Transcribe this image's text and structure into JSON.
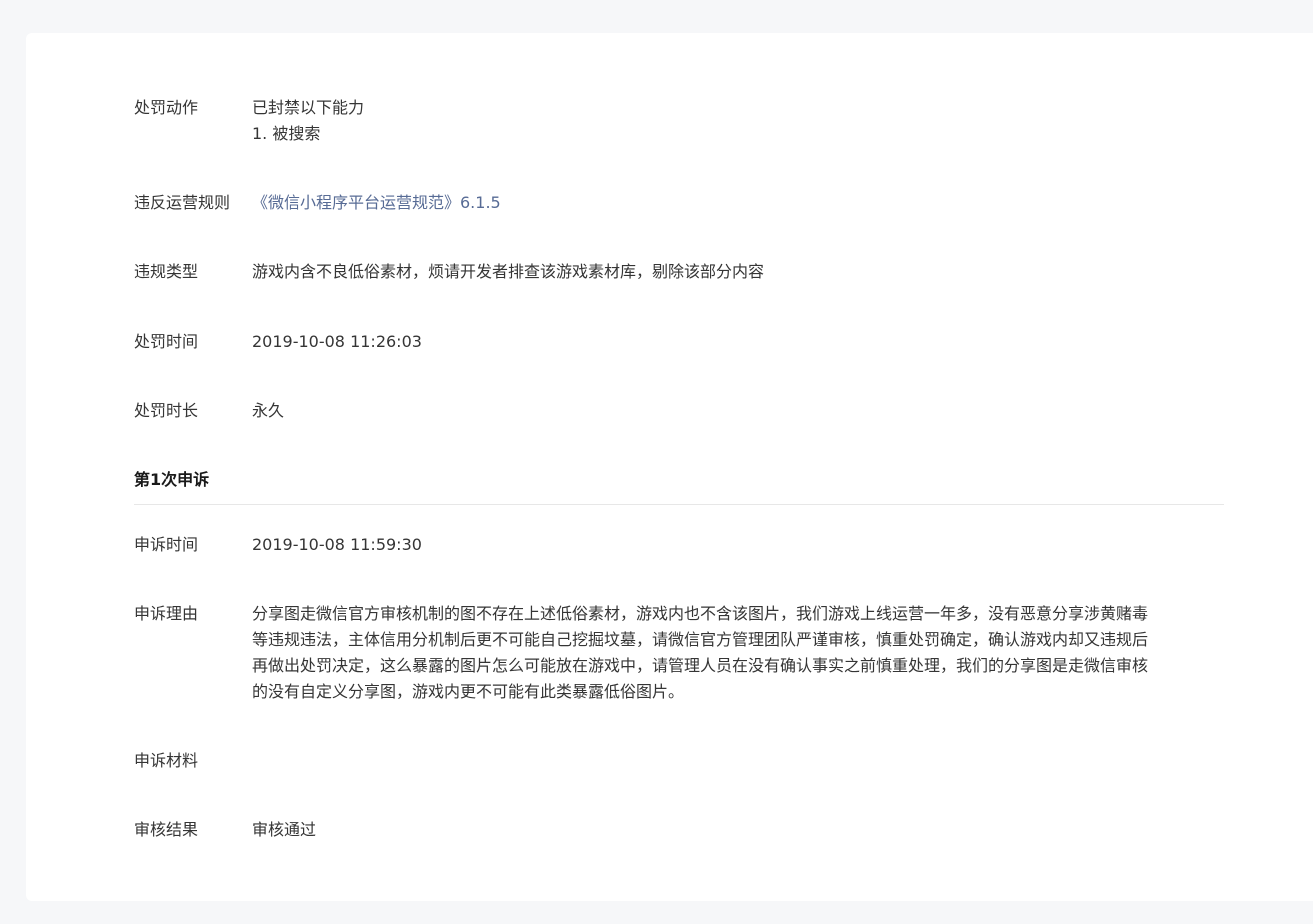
{
  "penalty": {
    "action_label": "处罚动作",
    "action_lines": [
      "已封禁以下能力",
      "1. 被搜索"
    ],
    "rule_label": "违反运营规则",
    "rule_link": "《微信小程序平台运营规范》6.1.5",
    "type_label": "违规类型",
    "type_value": "游戏内含不良低俗素材，烦请开发者排查该游戏素材库，剔除该部分内容",
    "time_label": "处罚时间",
    "time_value": "2019-10-08 11:26:03",
    "duration_label": "处罚时长",
    "duration_value": "永久"
  },
  "appeal": {
    "section_title": "第1次申诉",
    "time_label": "申诉时间",
    "time_value": "2019-10-08 11:59:30",
    "reason_label": "申诉理由",
    "reason_lines": [
      "分享图走微信官方审核机制的图不存在上述低俗素材，游戏内也不含该图片，我们游戏上线运营一年多，没有恶意分享涉黄赌毒",
      "等违规违法，主体信用分机制后更不可能自己挖掘坟墓，请微信官方管理团队严谨审核，慎重处罚确定，确认游戏内却又违规后",
      "再做出处罚决定，这么暴露的图片怎么可能放在游戏中，请管理人员在没有确认事实之前慎重处理，我们的分享图是走微信审核",
      "的没有自定义分享图，游戏内更不可能有此类暴露低俗图片。"
    ],
    "material_label": "申诉材料",
    "result_label": "审核结果",
    "result_value": "审核通过"
  },
  "colors": {
    "link": "#576b95",
    "text": "#353535",
    "background": "#f6f7f9",
    "card": "#ffffff"
  }
}
